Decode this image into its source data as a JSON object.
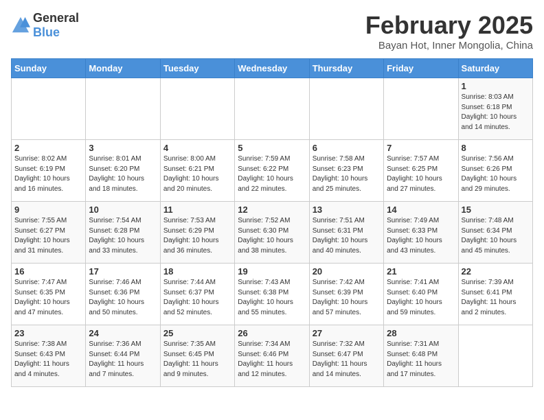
{
  "header": {
    "logo_general": "General",
    "logo_blue": "Blue",
    "month_title": "February 2025",
    "subtitle": "Bayan Hot, Inner Mongolia, China"
  },
  "weekdays": [
    "Sunday",
    "Monday",
    "Tuesday",
    "Wednesday",
    "Thursday",
    "Friday",
    "Saturday"
  ],
  "weeks": [
    [
      {
        "day": "",
        "info": ""
      },
      {
        "day": "",
        "info": ""
      },
      {
        "day": "",
        "info": ""
      },
      {
        "day": "",
        "info": ""
      },
      {
        "day": "",
        "info": ""
      },
      {
        "day": "",
        "info": ""
      },
      {
        "day": "1",
        "info": "Sunrise: 8:03 AM\nSunset: 6:18 PM\nDaylight: 10 hours\nand 14 minutes."
      }
    ],
    [
      {
        "day": "2",
        "info": "Sunrise: 8:02 AM\nSunset: 6:19 PM\nDaylight: 10 hours\nand 16 minutes."
      },
      {
        "day": "3",
        "info": "Sunrise: 8:01 AM\nSunset: 6:20 PM\nDaylight: 10 hours\nand 18 minutes."
      },
      {
        "day": "4",
        "info": "Sunrise: 8:00 AM\nSunset: 6:21 PM\nDaylight: 10 hours\nand 20 minutes."
      },
      {
        "day": "5",
        "info": "Sunrise: 7:59 AM\nSunset: 6:22 PM\nDaylight: 10 hours\nand 22 minutes."
      },
      {
        "day": "6",
        "info": "Sunrise: 7:58 AM\nSunset: 6:23 PM\nDaylight: 10 hours\nand 25 minutes."
      },
      {
        "day": "7",
        "info": "Sunrise: 7:57 AM\nSunset: 6:25 PM\nDaylight: 10 hours\nand 27 minutes."
      },
      {
        "day": "8",
        "info": "Sunrise: 7:56 AM\nSunset: 6:26 PM\nDaylight: 10 hours\nand 29 minutes."
      }
    ],
    [
      {
        "day": "9",
        "info": "Sunrise: 7:55 AM\nSunset: 6:27 PM\nDaylight: 10 hours\nand 31 minutes."
      },
      {
        "day": "10",
        "info": "Sunrise: 7:54 AM\nSunset: 6:28 PM\nDaylight: 10 hours\nand 33 minutes."
      },
      {
        "day": "11",
        "info": "Sunrise: 7:53 AM\nSunset: 6:29 PM\nDaylight: 10 hours\nand 36 minutes."
      },
      {
        "day": "12",
        "info": "Sunrise: 7:52 AM\nSunset: 6:30 PM\nDaylight: 10 hours\nand 38 minutes."
      },
      {
        "day": "13",
        "info": "Sunrise: 7:51 AM\nSunset: 6:31 PM\nDaylight: 10 hours\nand 40 minutes."
      },
      {
        "day": "14",
        "info": "Sunrise: 7:49 AM\nSunset: 6:33 PM\nDaylight: 10 hours\nand 43 minutes."
      },
      {
        "day": "15",
        "info": "Sunrise: 7:48 AM\nSunset: 6:34 PM\nDaylight: 10 hours\nand 45 minutes."
      }
    ],
    [
      {
        "day": "16",
        "info": "Sunrise: 7:47 AM\nSunset: 6:35 PM\nDaylight: 10 hours\nand 47 minutes."
      },
      {
        "day": "17",
        "info": "Sunrise: 7:46 AM\nSunset: 6:36 PM\nDaylight: 10 hours\nand 50 minutes."
      },
      {
        "day": "18",
        "info": "Sunrise: 7:44 AM\nSunset: 6:37 PM\nDaylight: 10 hours\nand 52 minutes."
      },
      {
        "day": "19",
        "info": "Sunrise: 7:43 AM\nSunset: 6:38 PM\nDaylight: 10 hours\nand 55 minutes."
      },
      {
        "day": "20",
        "info": "Sunrise: 7:42 AM\nSunset: 6:39 PM\nDaylight: 10 hours\nand 57 minutes."
      },
      {
        "day": "21",
        "info": "Sunrise: 7:41 AM\nSunset: 6:40 PM\nDaylight: 10 hours\nand 59 minutes."
      },
      {
        "day": "22",
        "info": "Sunrise: 7:39 AM\nSunset: 6:41 PM\nDaylight: 11 hours\nand 2 minutes."
      }
    ],
    [
      {
        "day": "23",
        "info": "Sunrise: 7:38 AM\nSunset: 6:43 PM\nDaylight: 11 hours\nand 4 minutes."
      },
      {
        "day": "24",
        "info": "Sunrise: 7:36 AM\nSunset: 6:44 PM\nDaylight: 11 hours\nand 7 minutes."
      },
      {
        "day": "25",
        "info": "Sunrise: 7:35 AM\nSunset: 6:45 PM\nDaylight: 11 hours\nand 9 minutes."
      },
      {
        "day": "26",
        "info": "Sunrise: 7:34 AM\nSunset: 6:46 PM\nDaylight: 11 hours\nand 12 minutes."
      },
      {
        "day": "27",
        "info": "Sunrise: 7:32 AM\nSunset: 6:47 PM\nDaylight: 11 hours\nand 14 minutes."
      },
      {
        "day": "28",
        "info": "Sunrise: 7:31 AM\nSunset: 6:48 PM\nDaylight: 11 hours\nand 17 minutes."
      },
      {
        "day": "",
        "info": ""
      }
    ]
  ]
}
